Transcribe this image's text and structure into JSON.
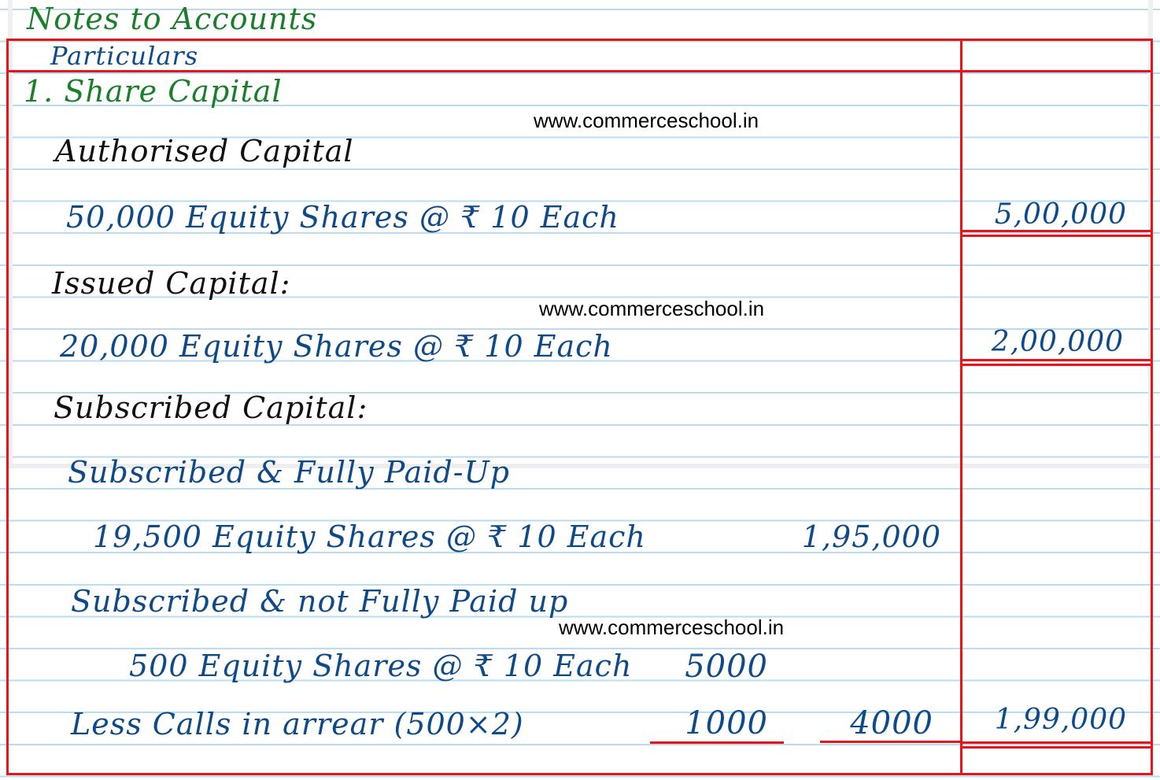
{
  "page_heading": "Notes to Accounts",
  "table": {
    "column_header_particulars": "Particulars",
    "column_header_amount": ""
  },
  "note": {
    "number_title": "1. Share Capital",
    "sections": {
      "authorised": {
        "heading": "Authorised Capital",
        "line": "50,000 Equity Shares @ ₹ 10 Each",
        "amount": "5,00,000"
      },
      "issued": {
        "heading": "Issued Capital:",
        "line": "20,000 Equity Shares @ ₹ 10 Each",
        "amount": "2,00,000"
      },
      "subscribed": {
        "heading": "Subscribed Capital:",
        "fully_paid_heading": "Subscribed & Fully Paid-Up",
        "fully_paid_line": "19,500 Equity Shares @ ₹ 10 Each",
        "fully_paid_amount": "1,95,000",
        "not_fully_paid_heading": "Subscribed & not Fully Paid up",
        "not_fully_paid_line": "500 Equity Shares @ ₹ 10 Each",
        "not_fully_paid_amount": "5000",
        "calls_in_arrear_line": "Less Calls in arrear (500×2)",
        "calls_in_arrear_amount": "1000",
        "net_not_fully_paid": "4000",
        "total_amount": "1,99,000"
      }
    }
  },
  "watermarks": [
    "www.commerceschool.in",
    "www.commerceschool.in",
    "www.commerceschool.in"
  ],
  "colors": {
    "heading_ink": "#1a7f2a",
    "subheading_ink": "#111111",
    "entry_ink": "#0e4a8a",
    "table_lines": "#e8141a",
    "ruling": "#b9dcf0"
  }
}
